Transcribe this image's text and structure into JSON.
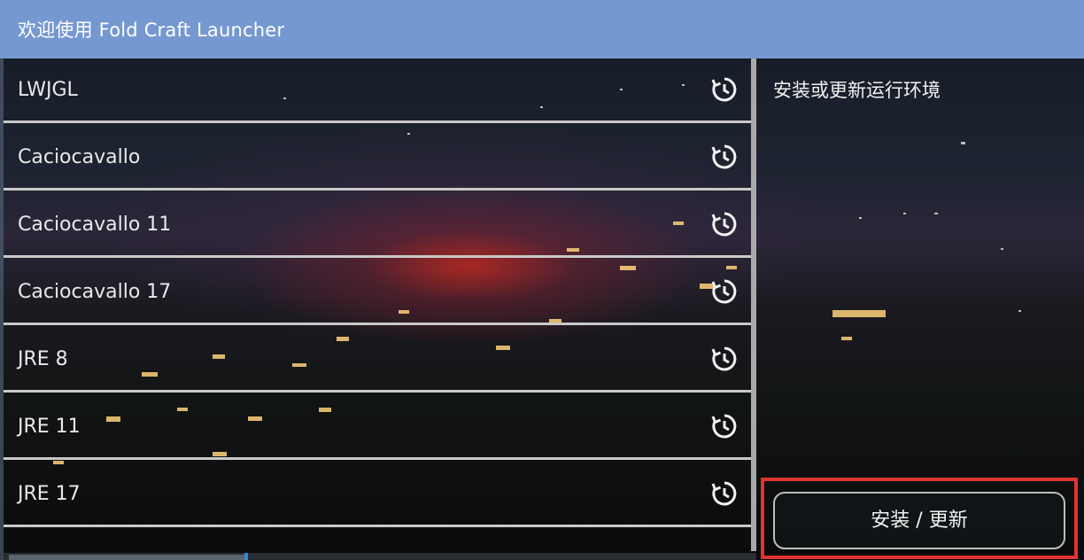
{
  "header": {
    "title": "欢迎使用 Fold Craft Launcher"
  },
  "runtimes": [
    {
      "label": "LWJGL",
      "icon": "refresh-clock-icon"
    },
    {
      "label": "Caciocavallo",
      "icon": "refresh-clock-icon"
    },
    {
      "label": "Caciocavallo 11",
      "icon": "refresh-clock-icon"
    },
    {
      "label": "Caciocavallo 17",
      "icon": "refresh-clock-icon"
    },
    {
      "label": "JRE 8",
      "icon": "refresh-clock-icon"
    },
    {
      "label": "JRE 11",
      "icon": "refresh-clock-icon"
    },
    {
      "label": "JRE 17",
      "icon": "refresh-clock-icon"
    }
  ],
  "panel": {
    "description": "安装或更新运行环境",
    "install_button": "安装 / 更新"
  },
  "colors": {
    "header": "#7598d0",
    "highlight": "#e03434",
    "divider": "#c9c9c9"
  }
}
